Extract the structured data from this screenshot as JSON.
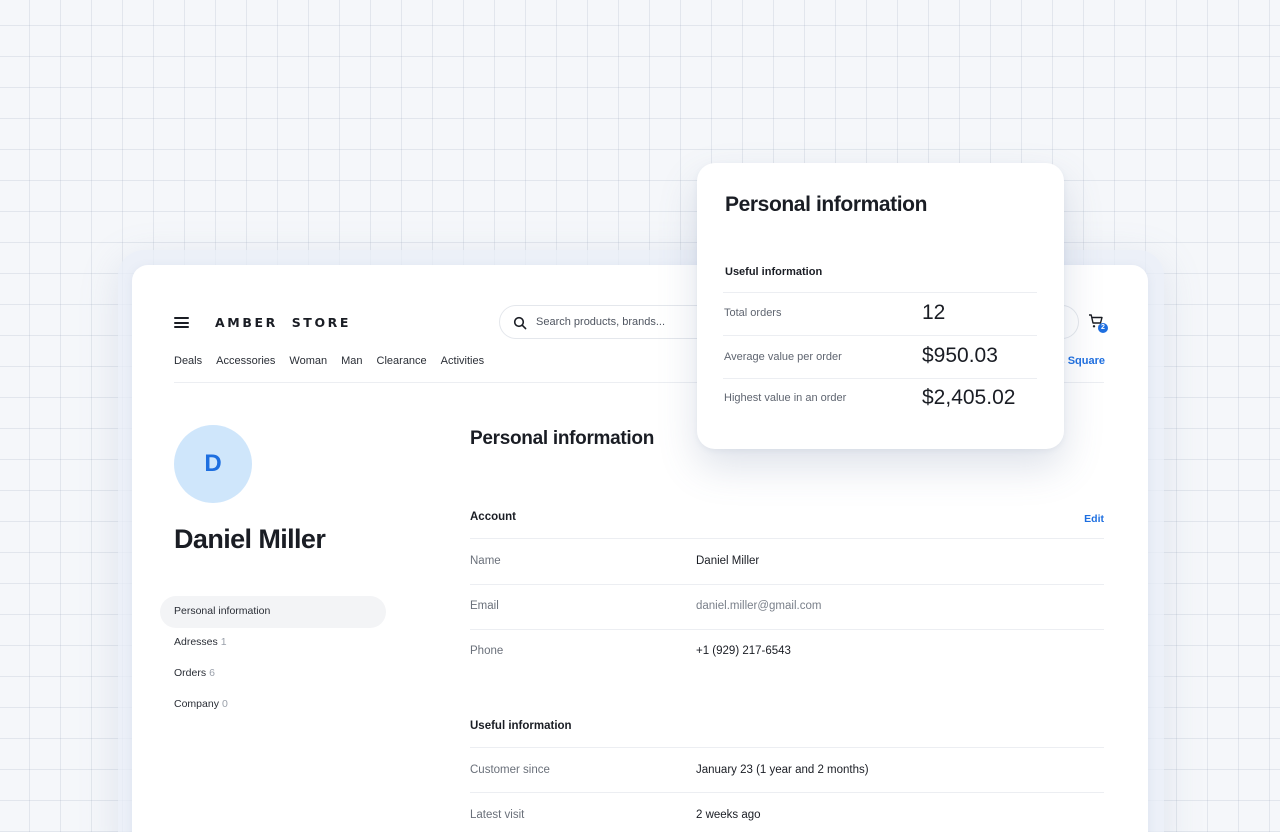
{
  "header": {
    "logo": "AMBER  STORE",
    "search_placeholder": "Search products, brands...",
    "cart_count": "2",
    "nav": [
      "Deals",
      "Accessories",
      "Woman",
      "Man",
      "Clearance",
      "Activities"
    ],
    "nav_right": "s Square"
  },
  "profile": {
    "initial": "D",
    "name": "Daniel Miller"
  },
  "sidebar": {
    "items": [
      {
        "label": "Personal information",
        "count": ""
      },
      {
        "label": "Adresses",
        "count": "1"
      },
      {
        "label": "Orders",
        "count": "6"
      },
      {
        "label": "Company",
        "count": "0"
      }
    ]
  },
  "main": {
    "title": "Personal information",
    "account": {
      "title": "Account",
      "edit_label": "Edit",
      "rows": [
        {
          "label": "Name",
          "value": "Daniel Miller"
        },
        {
          "label": "Email",
          "value": "daniel.miller@gmail.com"
        },
        {
          "label": "Phone",
          "value": "+1 (929) 217-6543"
        }
      ]
    },
    "useful": {
      "title": "Useful information",
      "rows": [
        {
          "label": "Customer since",
          "value": "January 23 (1 year and 2 months)"
        },
        {
          "label": "Latest visit",
          "value": "2 weeks ago"
        }
      ]
    }
  },
  "card": {
    "title": "Personal information",
    "subtitle": "Useful information",
    "rows": [
      {
        "label": "Total orders",
        "value": "12"
      },
      {
        "label": "Average value per order",
        "value": "$950.03"
      },
      {
        "label": "Highest value in an order",
        "value": "$2,405.02"
      }
    ]
  },
  "colors": {
    "accent": "#1e6fe0",
    "avatar_bg": "#cfe6fb"
  }
}
